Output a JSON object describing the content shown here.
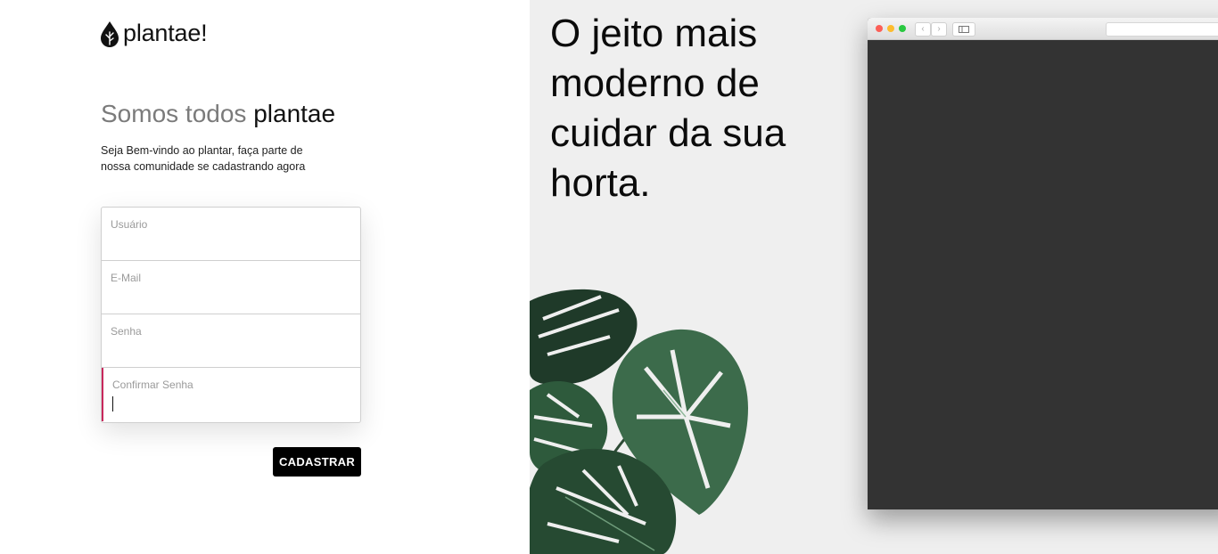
{
  "brand": {
    "name": "plantae!",
    "logo_icon": "leaf-drop-icon"
  },
  "signup": {
    "headline_muted": "Somos todos",
    "headline_strong": "plantae",
    "subtitle_line1": "Seja Bem-vindo ao plantar, faça parte de",
    "subtitle_line2": "nossa comunidade se cadastrando agora",
    "fields": [
      {
        "label": "Usuário",
        "value": ""
      },
      {
        "label": "E-Mail",
        "value": ""
      },
      {
        "label": "Senha",
        "value": ""
      },
      {
        "label": "Confirmar Senha",
        "value": "",
        "focused": true
      }
    ],
    "submit_label": "CADASTRAR"
  },
  "hero": {
    "tagline": "O jeito mais moderno de cuidar da sua horta."
  },
  "colors": {
    "accent_focus": "#c8285c",
    "button_bg": "#000000",
    "right_panel_bg": "#efefef",
    "browser_content": "#333333"
  }
}
